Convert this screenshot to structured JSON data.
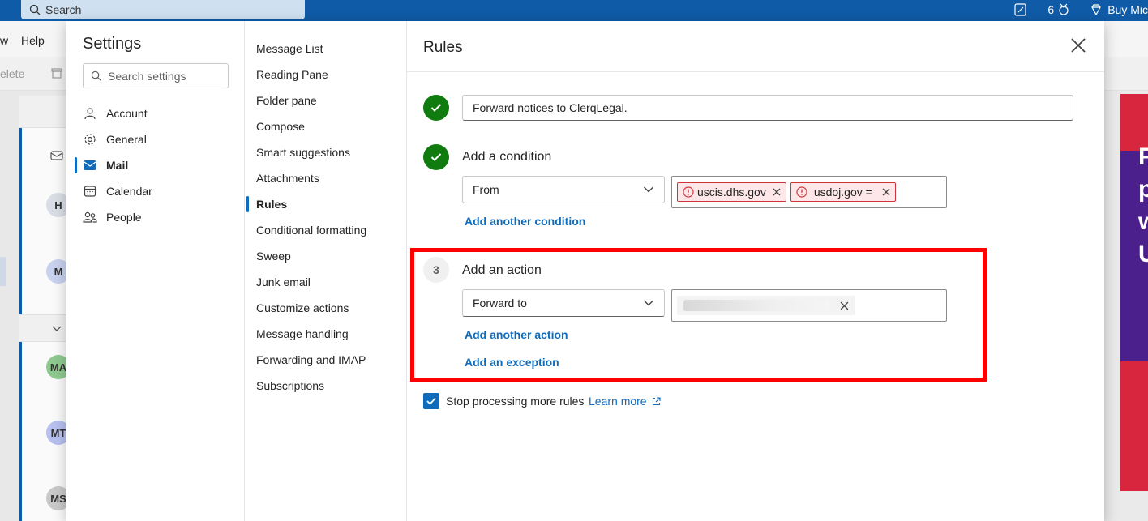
{
  "topbar": {
    "search_placeholder": "Search",
    "badge_count": "6",
    "buy_label": "Buy Mic"
  },
  "menubar": {
    "items": [
      "w",
      "Help"
    ]
  },
  "toolbar": {
    "delete_label": "elete"
  },
  "message_list": {
    "avatars": [
      "H",
      "M",
      "MA",
      "MT",
      "MS"
    ]
  },
  "ad": {
    "text": "F\np\nw\nU"
  },
  "settings": {
    "title": "Settings",
    "search_placeholder": "Search settings",
    "categories": [
      {
        "label": "Account",
        "icon": "person-icon"
      },
      {
        "label": "General",
        "icon": "gear-icon"
      },
      {
        "label": "Mail",
        "icon": "mail-icon",
        "active": true
      },
      {
        "label": "Calendar",
        "icon": "calendar-icon"
      },
      {
        "label": "People",
        "icon": "people-icon"
      }
    ],
    "subcategories": [
      "Message List",
      "Reading Pane",
      "Folder pane",
      "Compose",
      "Smart suggestions",
      "Attachments",
      "Rules",
      "Conditional formatting",
      "Sweep",
      "Junk email",
      "Customize actions",
      "Message handling",
      "Forwarding and IMAP",
      "Subscriptions"
    ],
    "active_subcategory": "Rules"
  },
  "rules": {
    "title": "Rules",
    "rule_name": "Forward notices to ClerqLegal.",
    "condition": {
      "label": "Add a condition",
      "field": "From",
      "values": [
        "uscis.dhs.gov",
        "usdoj.gov ="
      ],
      "add_link": "Add another condition"
    },
    "action": {
      "step_number": "3",
      "label": "Add an action",
      "field": "Forward to",
      "add_link": "Add another action",
      "exception_link": "Add an exception"
    },
    "stop_processing": {
      "label": "Stop processing more rules",
      "checked": true,
      "learn_more": "Learn more"
    }
  },
  "colors": {
    "accent": "#0f6cbd",
    "success": "#107c10",
    "error": "#d13438",
    "highlight": "#ff0000",
    "topbar": "#0f5ba7"
  }
}
